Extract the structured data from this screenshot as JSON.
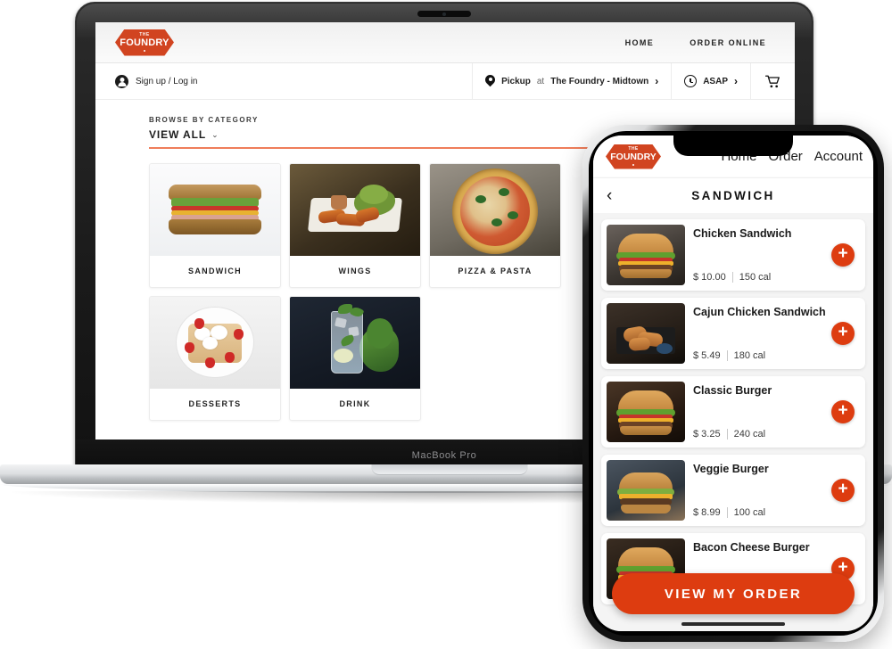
{
  "brand": {
    "logo_small": "THE",
    "logo_main": "FOUNDRY",
    "accent_color": "#dd3c10",
    "logo_color": "#d14420",
    "rule_color": "#ef7d5a"
  },
  "laptop": {
    "model_label": "MacBook Pro",
    "nav": [
      {
        "label": "HOME"
      },
      {
        "label": "ORDER ONLINE"
      }
    ],
    "account_bar": {
      "account_label": "Sign up / Log in",
      "pickup_prefix": "Pickup",
      "pickup_at": "at",
      "pickup_location": "The Foundry - Midtown",
      "time_label": "ASAP",
      "chevron": "›"
    },
    "browse": {
      "eyebrow": "BROWSE BY CATEGORY",
      "view_all": "VIEW ALL",
      "caret": "⌄"
    },
    "categories": [
      {
        "label": "SANDWICH",
        "image": "sandwich-photo"
      },
      {
        "label": "WINGS",
        "image": "wings-photo"
      },
      {
        "label": "PIZZA & PASTA",
        "image": "pizza-photo"
      },
      {
        "label": "DESSERTS",
        "image": "desserts-photo"
      },
      {
        "label": "DRINK",
        "image": "drink-photo"
      }
    ]
  },
  "phone": {
    "nav": [
      {
        "label": "Home"
      },
      {
        "label": "Order"
      },
      {
        "label": "Account"
      }
    ],
    "back_icon": "‹",
    "page_title": "SANDWICH",
    "add_icon": "+",
    "items": [
      {
        "name": "Chicken Sandwich",
        "price": "$ 10.00",
        "calories": "150 cal",
        "image": "chicken-sandwich-photo"
      },
      {
        "name": "Cajun Chicken Sandwich",
        "price": "$ 5.49",
        "calories": "180 cal",
        "image": "cajun-chicken-sandwich-photo"
      },
      {
        "name": "Classic Burger",
        "price": "$ 3.25",
        "calories": "240 cal",
        "image": "classic-burger-photo"
      },
      {
        "name": "Veggie Burger",
        "price": "$ 8.99",
        "calories": "100 cal",
        "image": "veggie-burger-photo"
      },
      {
        "name": "Bacon Cheese Burger",
        "price": "",
        "calories": "",
        "image": "bacon-cheese-burger-photo"
      }
    ],
    "cta_label": "VIEW MY ORDER"
  }
}
